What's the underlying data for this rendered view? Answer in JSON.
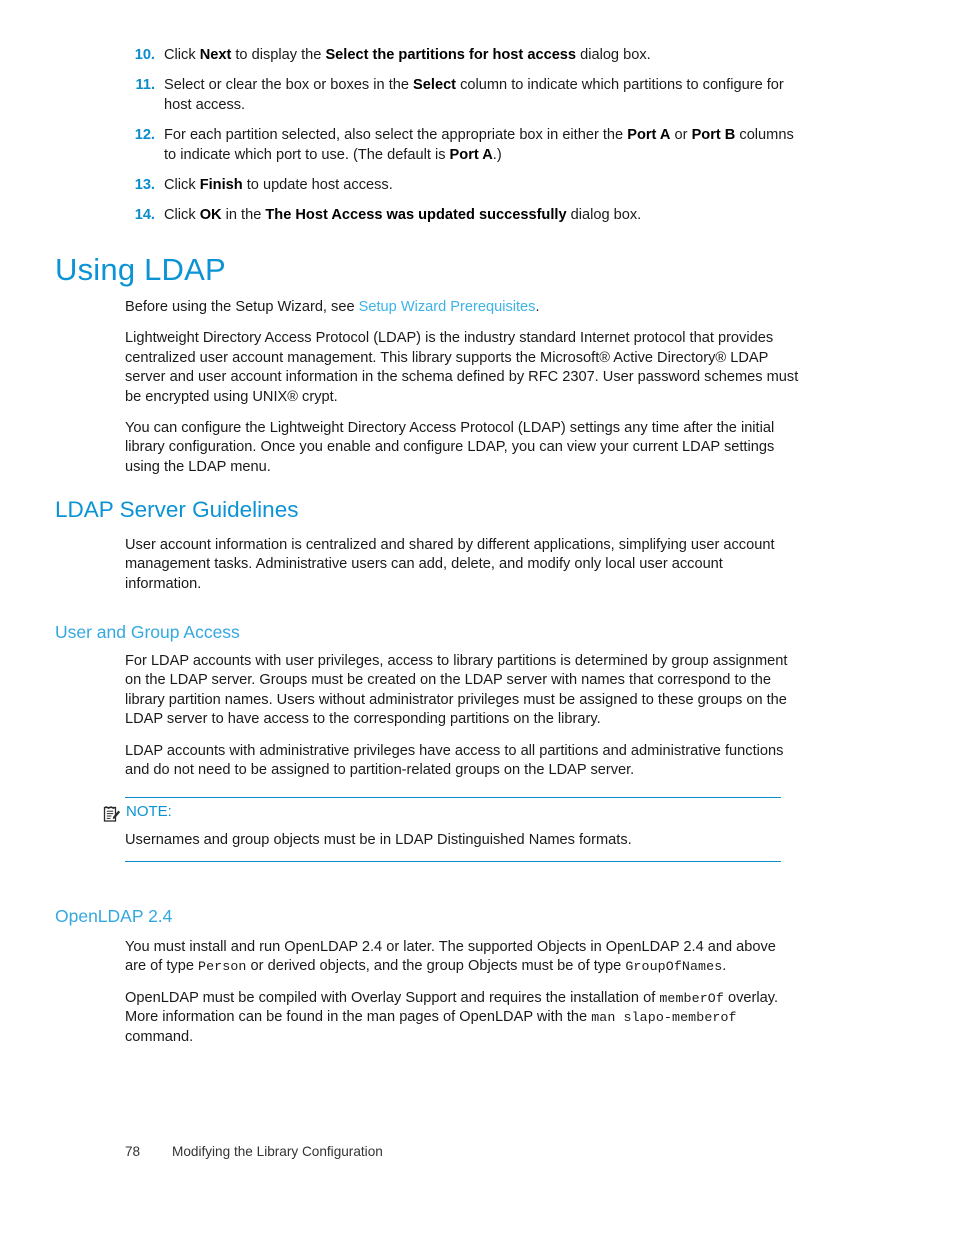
{
  "procedure": {
    "items": [
      {
        "number": "10.",
        "segments": [
          {
            "t": "Click ",
            "b": false
          },
          {
            "t": "Next",
            "b": true
          },
          {
            "t": " to display the ",
            "b": false
          },
          {
            "t": "Select the partitions for host access",
            "b": true
          },
          {
            "t": " dialog box.",
            "b": false
          }
        ]
      },
      {
        "number": "11.",
        "segments": [
          {
            "t": "Select or clear the box or boxes in the ",
            "b": false
          },
          {
            "t": "Select",
            "b": true
          },
          {
            "t": " column to indicate which partitions to configure for host access.",
            "b": false
          }
        ]
      },
      {
        "number": "12.",
        "segments": [
          {
            "t": "For each partition selected, also select the appropriate box in either the ",
            "b": false
          },
          {
            "t": "Port A",
            "b": true
          },
          {
            "t": " or ",
            "b": false
          },
          {
            "t": "Port B",
            "b": true
          },
          {
            "t": " columns to indicate which port to use. (The default is ",
            "b": false
          },
          {
            "t": "Port A",
            "b": true
          },
          {
            "t": ".)",
            "b": false
          }
        ]
      },
      {
        "number": "13.",
        "segments": [
          {
            "t": "Click ",
            "b": false
          },
          {
            "t": "Finish",
            "b": true
          },
          {
            "t": " to update host access.",
            "b": false
          }
        ]
      },
      {
        "number": "14.",
        "segments": [
          {
            "t": "Click ",
            "b": false
          },
          {
            "t": "OK",
            "b": true
          },
          {
            "t": " in the ",
            "b": false
          },
          {
            "t": "The Host Access was updated successfully",
            "b": true
          },
          {
            "t": " dialog box.",
            "b": false
          }
        ]
      }
    ]
  },
  "using_ldap": {
    "heading": "Using LDAP",
    "paragraphs": [
      {
        "segments": [
          {
            "t": "Before using the Setup Wizard, see ",
            "style": "plain"
          },
          {
            "t": "Setup Wizard Prerequisites",
            "style": "link"
          },
          {
            "t": ".",
            "style": "plain"
          }
        ]
      },
      {
        "segments": [
          {
            "t": "Lightweight Directory Access Protocol (LDAP) is the industry standard Internet protocol that provides centralized user account management. This library supports the Microsoft® Active Directory® LDAP server and user account information in the schema defined by RFC 2307. User password schemes must be encrypted using UNIX® crypt.",
            "style": "plain"
          }
        ]
      },
      {
        "segments": [
          {
            "t": "You can configure the Lightweight Directory Access Protocol (LDAP) settings any time after the initial library configuration. Once you enable and configure LDAP, you can view your current LDAP settings using the LDAP menu.",
            "style": "plain"
          }
        ]
      }
    ]
  },
  "ldap_server_guidelines": {
    "heading": "LDAP Server Guidelines",
    "paragraphs": [
      {
        "segments": [
          {
            "t": "User account information is centralized and shared by different applications, simplifying user account management tasks. Administrative users can add, delete, and modify only local user account information.",
            "style": "plain"
          }
        ]
      }
    ]
  },
  "user_and_group_access": {
    "heading": "User and Group Access",
    "paragraphs": [
      {
        "segments": [
          {
            "t": "For LDAP accounts with user privileges, access to library partitions is determined by group assignment on the LDAP server. Groups must be created on the LDAP server with names that correspond to the library partition names. Users without administrator privileges must be assigned to these groups on the LDAP server to have access to the corresponding partitions on the library.",
            "style": "plain"
          }
        ]
      },
      {
        "segments": [
          {
            "t": "LDAP accounts with administrative privileges have access to all partitions and administrative functions and do not need to be assigned to partition-related groups on the LDAP server.",
            "style": "plain"
          }
        ]
      }
    ]
  },
  "note": {
    "icon": "note-memo-icon",
    "label": "NOTE:",
    "text": "Usernames and group objects must be in LDAP Distinguished Names formats."
  },
  "openldap": {
    "heading": "OpenLDAP 2.4",
    "paragraphs": [
      {
        "segments": [
          {
            "t": "You must install and run OpenLDAP 2.4 or later. The supported Objects in OpenLDAP 2.4 and above are of type ",
            "style": "plain"
          },
          {
            "t": "Person",
            "style": "mono"
          },
          {
            "t": " or derived objects, and the group Objects must be of type ",
            "style": "plain"
          },
          {
            "t": "GroupOfNames",
            "style": "mono"
          },
          {
            "t": ".",
            "style": "plain"
          }
        ]
      },
      {
        "segments": [
          {
            "t": "OpenLDAP must be compiled with Overlay Support and requires the installation of ",
            "style": "plain"
          },
          {
            "t": "memberOf",
            "style": "mono"
          },
          {
            "t": " overlay. More information can be found in the man pages of OpenLDAP with the ",
            "style": "plain"
          },
          {
            "t": "man slapo-memberof",
            "style": "mono"
          },
          {
            "t": " command.",
            "style": "plain"
          }
        ]
      }
    ]
  },
  "footer": {
    "page_number": "78",
    "title": "Modifying the Library Configuration"
  },
  "colors": {
    "heading_blue": "#0b93d5",
    "rule_blue": "#0b8ccc",
    "link_blue": "#3cb3e8",
    "number_blue": "#0b8ccc",
    "body_text": "#1a1a1a"
  }
}
